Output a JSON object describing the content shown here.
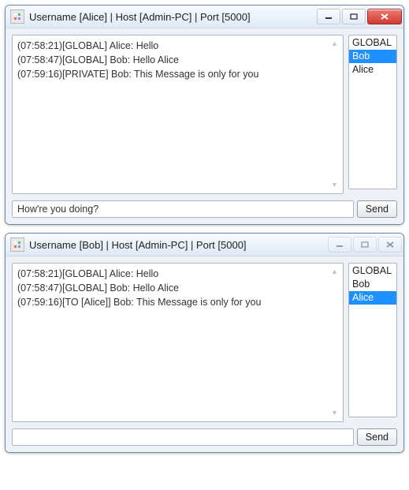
{
  "windows": [
    {
      "title": "Username [Alice] | Host [Admin-PC] | Port [5000]",
      "controls": {
        "min": true,
        "max": true,
        "close": true,
        "close_enabled": true,
        "dim": false
      },
      "messages": [
        "(07:58:21)[GLOBAL] Alice: Hello",
        "(07:58:47)[GLOBAL] Bob: Hello Alice",
        "(07:59:16)[PRIVATE] Bob: This Message is only for you"
      ],
      "users": [
        "GLOBAL",
        "Bob",
        "Alice"
      ],
      "selected_user_index": 1,
      "input_value": "How're you doing?",
      "send_label": "Send"
    },
    {
      "title": "Username [Bob] | Host [Admin-PC] | Port [5000]",
      "controls": {
        "min": true,
        "max": true,
        "close": true,
        "close_enabled": false,
        "dim": true
      },
      "messages": [
        "(07:58:21)[GLOBAL] Alice: Hello",
        "(07:58:47)[GLOBAL] Bob: Hello Alice",
        "(07:59:16)[TO [Alice]] Bob: This Message is only for you"
      ],
      "users": [
        "GLOBAL",
        "Bob",
        "Alice"
      ],
      "selected_user_index": 2,
      "input_value": "",
      "send_label": "Send"
    }
  ]
}
